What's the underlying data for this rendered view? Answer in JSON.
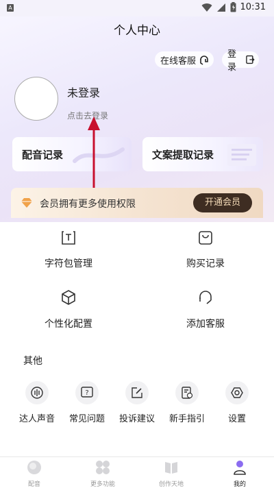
{
  "status_bar": {
    "time": "10:31"
  },
  "header": {
    "title": "个人中心"
  },
  "top_actions": {
    "service_label": "在线客服",
    "login_label": "登录"
  },
  "profile": {
    "name": "未登录",
    "hint": "点击去登录"
  },
  "records": {
    "dub_label": "配音记录",
    "text_extract_label": "文案提取记录"
  },
  "vip": {
    "text": "会员拥有更多使用权限",
    "button_label": "开通会员"
  },
  "grid": [
    {
      "label": "字符包管理",
      "icon": "text-box-icon"
    },
    {
      "label": "购买记录",
      "icon": "shopping-bag-icon"
    },
    {
      "label": "个性化配置",
      "icon": "cube-icon"
    },
    {
      "label": "添加客服",
      "icon": "headset-icon"
    }
  ],
  "other": {
    "title": "其他",
    "items": [
      {
        "label": "达人声音",
        "icon": "voice-icon"
      },
      {
        "label": "常见问题",
        "icon": "question-icon"
      },
      {
        "label": "投诉建议",
        "icon": "edit-icon"
      },
      {
        "label": "新手指引",
        "icon": "guide-icon"
      },
      {
        "label": "设置",
        "icon": "settings-icon"
      }
    ]
  },
  "tabs": [
    {
      "label": "配音",
      "icon": "dub-icon"
    },
    {
      "label": "更多功能",
      "icon": "more-functions-icon"
    },
    {
      "label": "创作天地",
      "icon": "book-icon"
    },
    {
      "label": "我的",
      "icon": "profile-icon",
      "active": true
    }
  ],
  "colors": {
    "accent_purple": "#8b6cf0",
    "vip_button_bg": "#3e2d22",
    "vip_button_text": "#f5dcb8",
    "arrow_red": "#c8102e"
  }
}
